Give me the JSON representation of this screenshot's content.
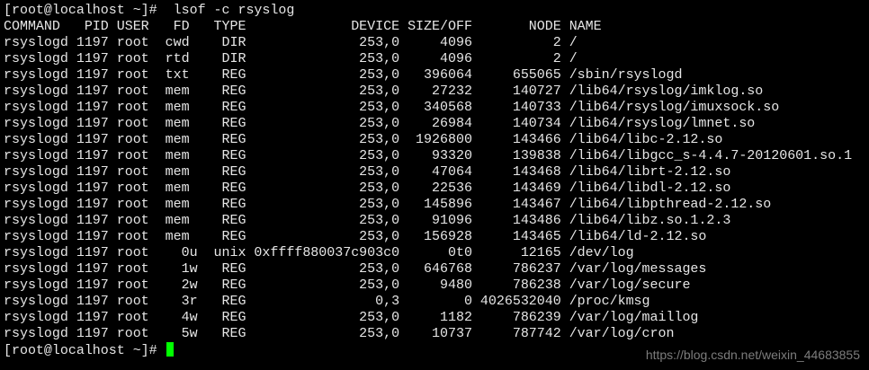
{
  "terminal": {
    "prompt": "[root@localhost ~]# ",
    "command": " lsof -c rsyslog",
    "output_lines": [
      "COMMAND   PID USER   FD   TYPE             DEVICE SIZE/OFF       NODE NAME",
      "rsyslogd 1197 root  cwd    DIR              253,0     4096          2 /",
      "rsyslogd 1197 root  rtd    DIR              253,0     4096          2 /",
      "rsyslogd 1197 root  txt    REG              253,0   396064     655065 /sbin/rsyslogd",
      "rsyslogd 1197 root  mem    REG              253,0    27232     140727 /lib64/rsyslog/imklog.so",
      "rsyslogd 1197 root  mem    REG              253,0   340568     140733 /lib64/rsyslog/imuxsock.so",
      "rsyslogd 1197 root  mem    REG              253,0    26984     140734 /lib64/rsyslog/lmnet.so",
      "rsyslogd 1197 root  mem    REG              253,0  1926800     143466 /lib64/libc-2.12.so",
      "rsyslogd 1197 root  mem    REG              253,0    93320     139838 /lib64/libgcc_s-4.4.7-20120601.so.1",
      "rsyslogd 1197 root  mem    REG              253,0    47064     143468 /lib64/librt-2.12.so",
      "rsyslogd 1197 root  mem    REG              253,0    22536     143469 /lib64/libdl-2.12.so",
      "rsyslogd 1197 root  mem    REG              253,0   145896     143467 /lib64/libpthread-2.12.so",
      "rsyslogd 1197 root  mem    REG              253,0    91096     143486 /lib64/libz.so.1.2.3",
      "rsyslogd 1197 root  mem    REG              253,0   156928     143465 /lib64/ld-2.12.so",
      "rsyslogd 1197 root    0u  unix 0xffff880037c903c0      0t0      12165 /dev/log",
      "rsyslogd 1197 root    1w   REG              253,0   646768     786237 /var/log/messages",
      "rsyslogd 1197 root    2w   REG              253,0     9480     786238 /var/log/secure",
      "rsyslogd 1197 root    3r   REG                0,3        0 4026532040 /proc/kmsg",
      "rsyslogd 1197 root    4w   REG              253,0     1182     786239 /var/log/maillog",
      "rsyslogd 1197 root    5w   REG              253,0    10737     787742 /var/log/cron"
    ],
    "final_prompt": "[root@localhost ~]# ",
    "cursor_color": "#00ff00",
    "text_color": "#e6e6e6",
    "background_color": "#000000"
  },
  "watermark": {
    "text": "https://blog.csdn.net/weixin_44683855"
  }
}
